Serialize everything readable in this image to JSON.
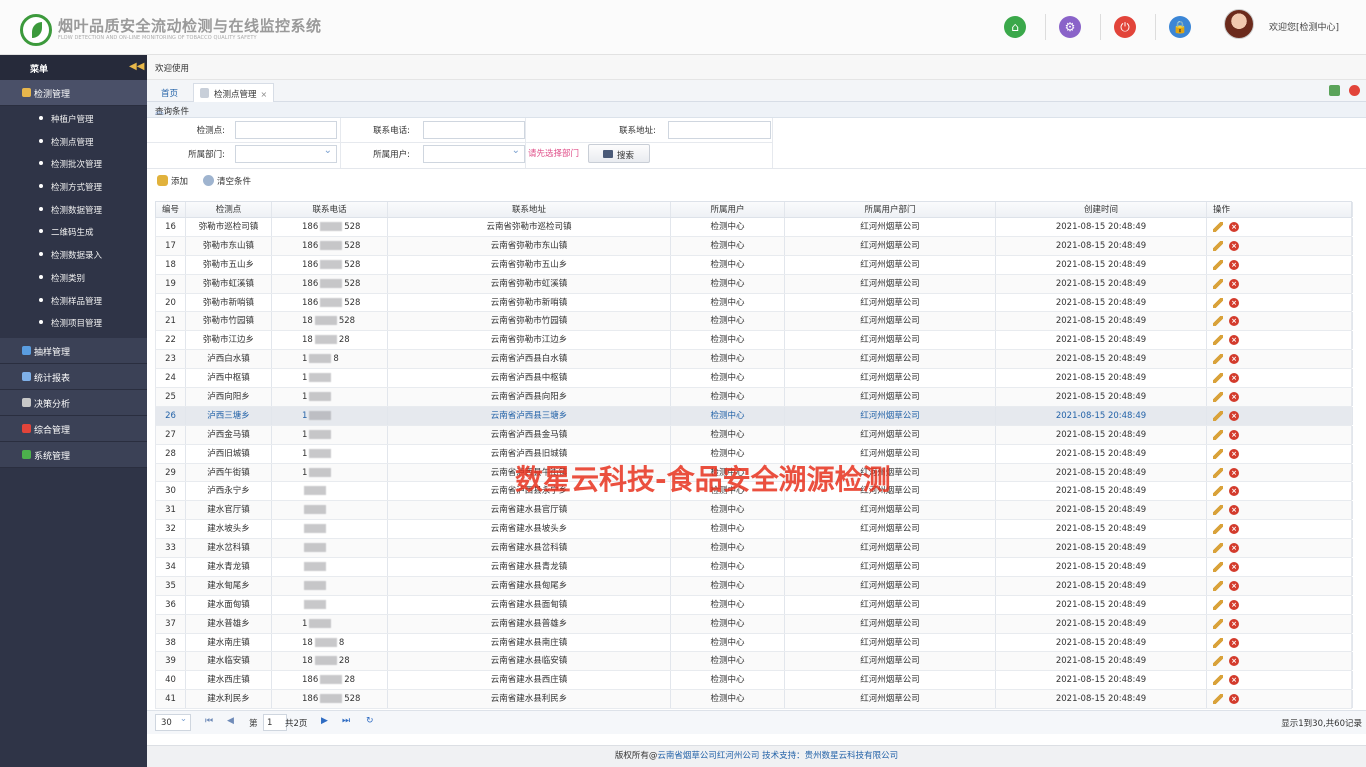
{
  "app": {
    "title": "烟叶品质安全流动检测与在线监控系统",
    "subtitle": "FLOW DETECTION AND ON-LINE MONITORING OF TOBACCO QUALITY SAFETY",
    "welcome": "欢迎您[检测中心]"
  },
  "top_icons": [
    {
      "name": "home-icon",
      "color": "#3aa84a",
      "glyph": "⌂"
    },
    {
      "name": "gear-icon",
      "color": "#8a63c9",
      "glyph": "⚙"
    },
    {
      "name": "power-icon",
      "color": "#e2443a",
      "glyph": "⏻"
    },
    {
      "name": "lock-icon",
      "color": "#3b86d6",
      "glyph": "🔒"
    }
  ],
  "sidebar": {
    "title": "菜单",
    "collapse_icon": "double-chevron-left-icon",
    "groups": [
      {
        "label": "检测管理",
        "icon_color": "#e7b64c",
        "active": true,
        "items": [
          "种植户管理",
          "检测点管理",
          "检测批次管理",
          "检测方式管理",
          "检测数据管理",
          "二维码生成",
          "检测数据录入",
          "检测类别",
          "检测样品管理",
          "检测项目管理"
        ]
      },
      {
        "label": "抽样管理",
        "icon_color": "#5a9de0"
      },
      {
        "label": "统计报表",
        "icon_color": "#7fb0e8"
      },
      {
        "label": "决策分析",
        "icon_color": "#c8c8c8"
      },
      {
        "label": "综合管理",
        "icon_color": "#e2443a"
      },
      {
        "label": "系统管理",
        "icon_color": "#4cb14c"
      }
    ]
  },
  "breadcrumb": "欢迎使用",
  "tabs": {
    "home": "首页",
    "current": "检测点管理",
    "close": "×"
  },
  "query": {
    "title": "查询条件",
    "labels": {
      "point": "检测点:",
      "phone": "联系电话:",
      "address": "联系地址:",
      "dept": "所属部门:",
      "user": "所属用户:"
    },
    "hint": "请先选择部门",
    "search_label": "搜索"
  },
  "toolbar": {
    "add_label": "添加",
    "clear_label": "清空条件"
  },
  "grid": {
    "columns": [
      "编号",
      "检测点",
      "联系电话",
      "联系地址",
      "所属用户",
      "所属用户部门",
      "创建时间",
      "操作"
    ],
    "selected_row": 26,
    "rows": [
      {
        "id": "16",
        "point": "弥勒市巡检司镇",
        "phone_head": "186",
        "phone_tail": "528",
        "address": "云南省弥勒市巡检司镇"
      },
      {
        "id": "17",
        "point": "弥勒市东山镇",
        "phone_head": "186",
        "phone_tail": "528",
        "address": "云南省弥勒市东山镇"
      },
      {
        "id": "18",
        "point": "弥勒市五山乡",
        "phone_head": "186",
        "phone_tail": "528",
        "address": "云南省弥勒市五山乡"
      },
      {
        "id": "19",
        "point": "弥勒市虹溪镇",
        "phone_head": "186",
        "phone_tail": "528",
        "address": "云南省弥勒市虹溪镇"
      },
      {
        "id": "20",
        "point": "弥勒市新哨镇",
        "phone_head": "186",
        "phone_tail": "528",
        "address": "云南省弥勒市新哨镇"
      },
      {
        "id": "21",
        "point": "弥勒市竹园镇",
        "phone_head": "18",
        "phone_tail": "528",
        "address": "云南省弥勒市竹园镇"
      },
      {
        "id": "22",
        "point": "弥勒市江边乡",
        "phone_head": "18",
        "phone_tail": "28",
        "address": "云南省弥勒市江边乡"
      },
      {
        "id": "23",
        "point": "泸西白水镇",
        "phone_head": "1",
        "phone_tail": "8",
        "address": "云南省泸西县白水镇"
      },
      {
        "id": "24",
        "point": "泸西中枢镇",
        "phone_head": "1",
        "phone_tail": "",
        "address": "云南省泸西县中枢镇"
      },
      {
        "id": "25",
        "point": "泸西向阳乡",
        "phone_head": "1",
        "phone_tail": "",
        "address": "云南省泸西县向阳乡"
      },
      {
        "id": "26",
        "point": "泸西三塘乡",
        "phone_head": "1",
        "phone_tail": "",
        "address": "云南省泸西县三塘乡"
      },
      {
        "id": "27",
        "point": "泸西金马镇",
        "phone_head": "1",
        "phone_tail": "",
        "address": "云南省泸西县金马镇"
      },
      {
        "id": "28",
        "point": "泸西旧城镇",
        "phone_head": "1",
        "phone_tail": "",
        "address": "云南省泸西县旧城镇"
      },
      {
        "id": "29",
        "point": "泸西午街镇",
        "phone_head": "1",
        "phone_tail": "",
        "address": "云南省泸西县午街镇"
      },
      {
        "id": "30",
        "point": "泸西永宁乡",
        "phone_head": "",
        "phone_tail": "",
        "address": "云南省泸西县永宁乡"
      },
      {
        "id": "31",
        "point": "建水官厅镇",
        "phone_head": "",
        "phone_tail": "",
        "address": "云南省建水县官厅镇"
      },
      {
        "id": "32",
        "point": "建水坡头乡",
        "phone_head": "",
        "phone_tail": "",
        "address": "云南省建水县坡头乡"
      },
      {
        "id": "33",
        "point": "建水岔科镇",
        "phone_head": "",
        "phone_tail": "",
        "address": "云南省建水县岔科镇"
      },
      {
        "id": "34",
        "point": "建水青龙镇",
        "phone_head": "",
        "phone_tail": "",
        "address": "云南省建水县青龙镇"
      },
      {
        "id": "35",
        "point": "建水甸尾乡",
        "phone_head": "",
        "phone_tail": "",
        "address": "云南省建水县甸尾乡"
      },
      {
        "id": "36",
        "point": "建水面甸镇",
        "phone_head": "",
        "phone_tail": "",
        "address": "云南省建水县面甸镇"
      },
      {
        "id": "37",
        "point": "建水普雄乡",
        "phone_head": "1",
        "phone_tail": "",
        "address": "云南省建水县普雄乡"
      },
      {
        "id": "38",
        "point": "建水南庄镇",
        "phone_head": "18",
        "phone_tail": "8",
        "address": "云南省建水县南庄镇"
      },
      {
        "id": "39",
        "point": "建水临安镇",
        "phone_head": "18",
        "phone_tail": "28",
        "address": "云南省建水县临安镇"
      },
      {
        "id": "40",
        "point": "建水西庄镇",
        "phone_head": "186",
        "phone_tail": "28",
        "address": "云南省建水县西庄镇"
      },
      {
        "id": "41",
        "point": "建水利民乡",
        "phone_head": "186",
        "phone_tail": "528",
        "address": "云南省建水县利民乡"
      }
    ],
    "common": {
      "user": "检测中心",
      "dept": "红河州烟草公司",
      "time": "2021-08-15 20:48:49"
    }
  },
  "pager": {
    "size": "30",
    "page_label": "第",
    "page": "1",
    "total_pages": "共2页",
    "info": "显示1到30,共60记录"
  },
  "footer": {
    "prefix": "版权所有@",
    "owner": "云南省烟草公司红河州公司",
    "tech_label": " 技术支持：",
    "tech": "贵州数星云科技有限公司"
  },
  "watermark": "数星云科技-食品安全溯源检测"
}
